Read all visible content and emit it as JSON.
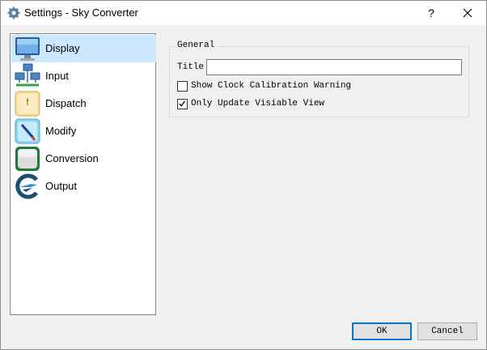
{
  "window": {
    "title": "Settings - Sky Converter",
    "help_label": "?",
    "title_icon": "gear-icon",
    "close_icon": "close-icon"
  },
  "nav": {
    "items": [
      {
        "label": "Display",
        "icon": "monitor-icon",
        "selected": true
      },
      {
        "label": "Input",
        "icon": "network-icon",
        "selected": false
      },
      {
        "label": "Dispatch",
        "icon": "dispatch-icon",
        "selected": false
      },
      {
        "label": "Modify",
        "icon": "pen-icon",
        "selected": false
      },
      {
        "label": "Conversion",
        "icon": "conversion-icon",
        "selected": false
      },
      {
        "label": "Output",
        "icon": "output-icon",
        "selected": false
      }
    ]
  },
  "general": {
    "group_title": "General",
    "title_label": "Title",
    "title_value": "",
    "show_clock_label": "Show Clock Calibration Warning",
    "show_clock_checked": false,
    "only_update_label": "Only Update Visiable View",
    "only_update_checked": true
  },
  "buttons": {
    "ok": "OK",
    "cancel": "Cancel"
  },
  "colors": {
    "selection": "#cce8ff",
    "accent": "#0078d7"
  }
}
